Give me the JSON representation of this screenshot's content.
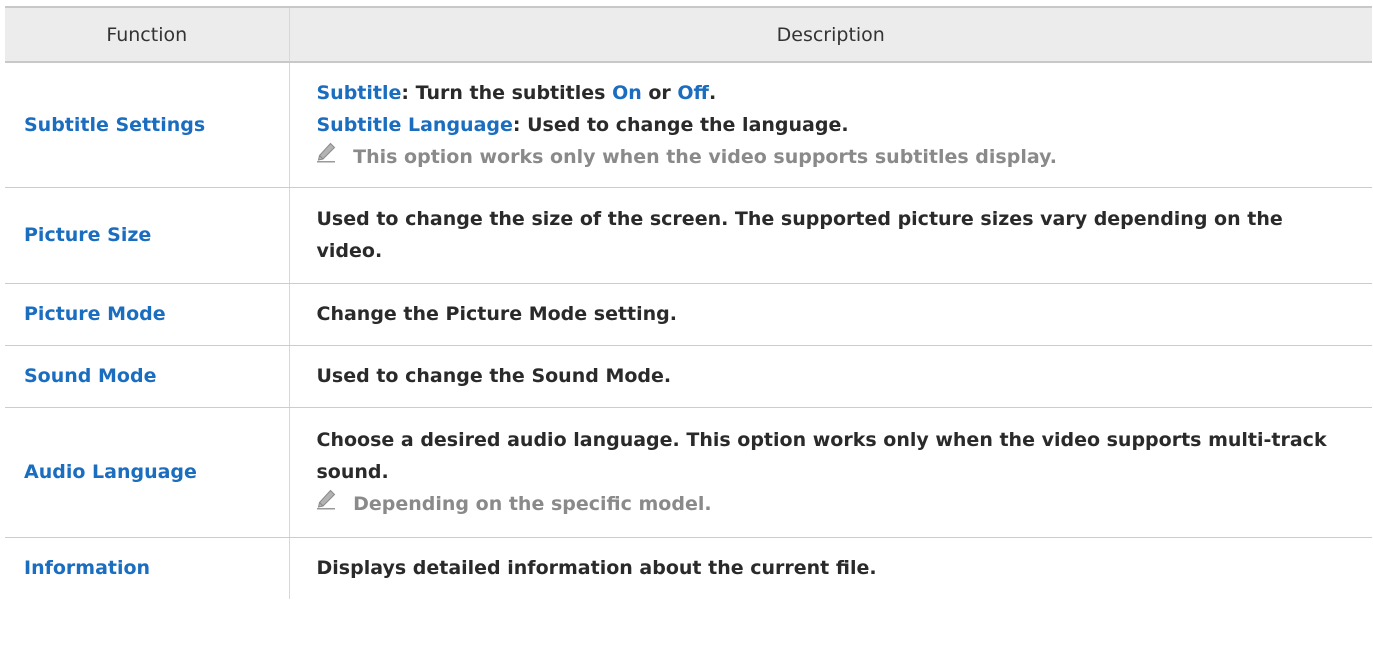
{
  "header": {
    "function": "Function",
    "description": "Description"
  },
  "rows": [
    {
      "function": "Subtitle Settings",
      "lines": [
        {
          "label": "Subtitle",
          "sep": ": Turn the subtitles ",
          "on": "On",
          "or": " or ",
          "off": "Off",
          "end": "."
        },
        {
          "label": "Subtitle Language",
          "text": ": Used to change the language."
        }
      ],
      "note": "This option works only when the video supports subtitles display."
    },
    {
      "function": "Picture Size",
      "text": "Used to change the size of the screen. The supported picture sizes vary depending on the video."
    },
    {
      "function": "Picture Mode",
      "text": "Change the Picture Mode setting."
    },
    {
      "function": "Sound Mode",
      "text": "Used to change the Sound Mode."
    },
    {
      "function": "Audio Language",
      "text": "Choose a desired audio language. This option works only when the video supports multi-track sound.",
      "note": "Depending on the specific model."
    },
    {
      "function": "Information",
      "text": "Displays detailed information about the current file."
    }
  ],
  "colors": {
    "link_blue": "#1a6dbf",
    "note_gray": "#8a8a8a",
    "header_bg": "#ececec"
  },
  "icons": {
    "note": "pencil-icon"
  }
}
